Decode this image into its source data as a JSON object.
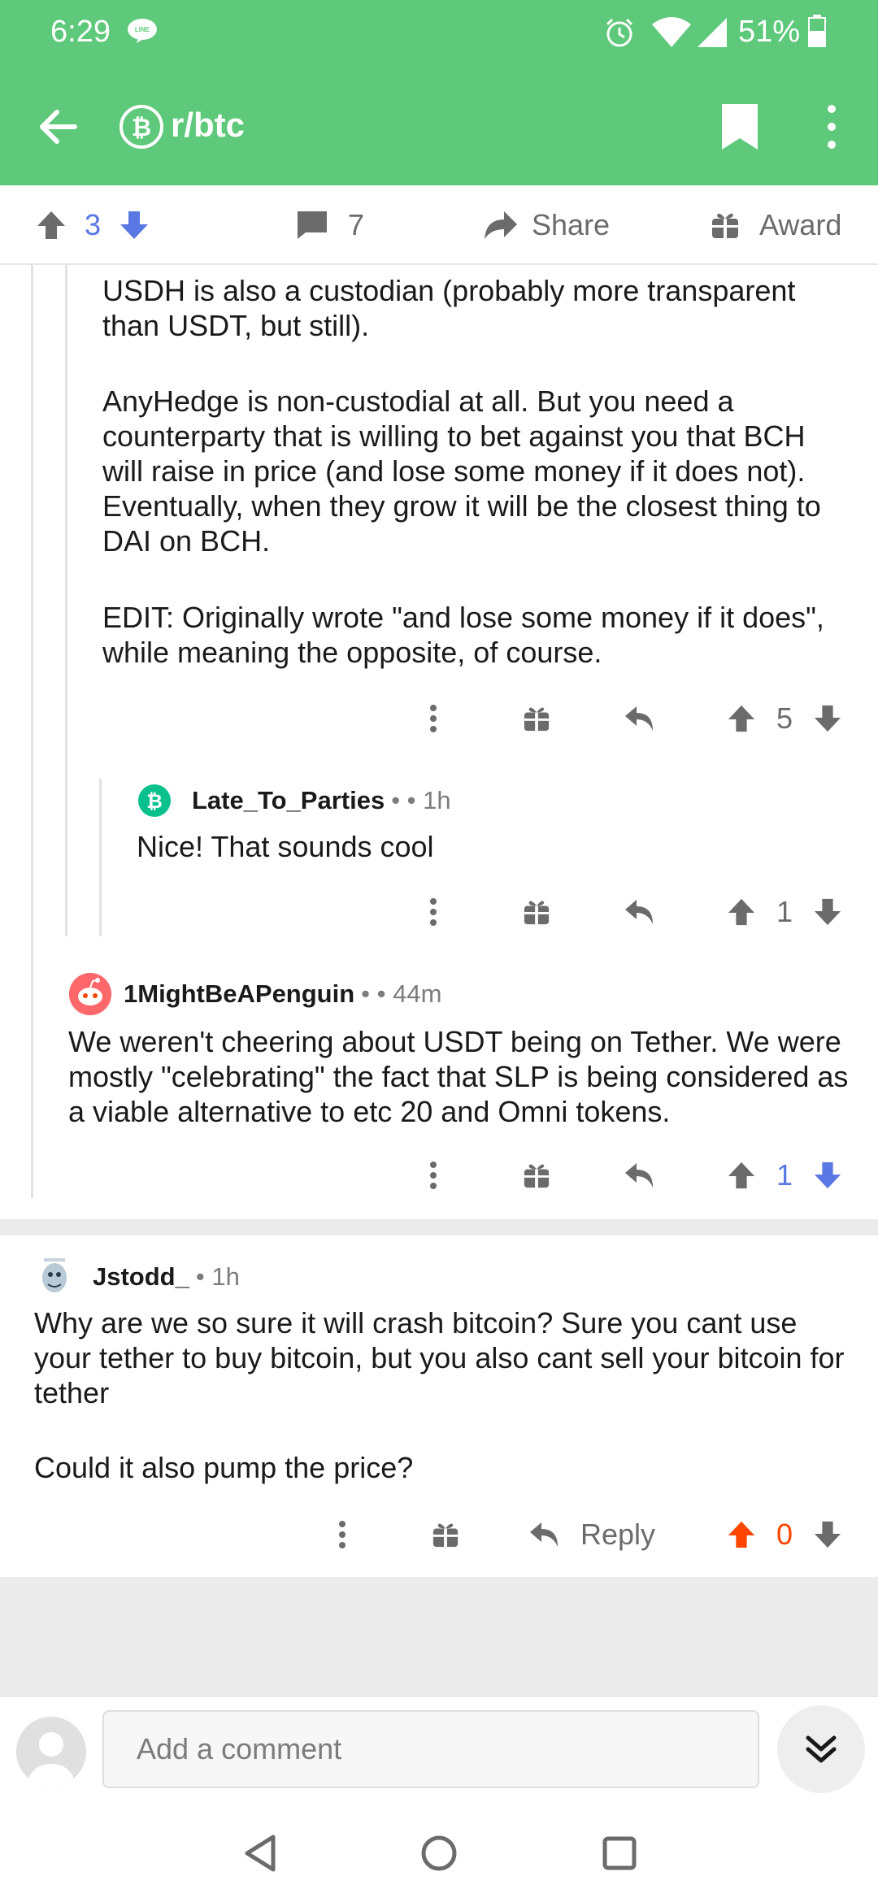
{
  "status_bar": {
    "time": "6:29",
    "battery_percent": "51%",
    "icons": [
      "line-app-icon",
      "alarm-icon",
      "wifi-icon",
      "cell-signal-icon",
      "battery-icon"
    ]
  },
  "toolbar": {
    "subreddit": "r/btc",
    "icons": [
      "back-arrow-icon",
      "bitcoin-subreddit-icon",
      "bookmark-icon",
      "more-vert-icon"
    ]
  },
  "post_actions": {
    "vote_count": "3",
    "comment_count": "7",
    "share_label": "Share",
    "award_label": "Award"
  },
  "comments": [
    {
      "paragraphs": [
        "USDH is also a custodian (probably more transparent than USDT, but still).",
        "AnyHedge is non-custodial at all. But you need a counterparty that is willing to bet against you that BCH will raise in price (and lose some money if it does not). Eventually, when they grow it will be the closest thing to DAI on BCH.",
        "EDIT: Originally wrote \"and lose some money if it does\", while meaning the opposite, of course."
      ],
      "score": "5"
    },
    {
      "author": "Late_To_Parties",
      "meta": "• • 1h",
      "body": "Nice! That sounds cool",
      "score": "1"
    },
    {
      "author": "1MightBeAPenguin",
      "meta": "• • 44m",
      "body": "We weren't cheering about USDT being on Tether. We were mostly \"celebrating\" the fact that SLP is being considered as a viable alternative to etc 20 and Omni tokens.",
      "score": "1"
    },
    {
      "author": "Jstodd_",
      "meta": "• 1h",
      "paragraphs": [
        "Why are we so sure it will crash bitcoin? Sure you cant use your tether to buy bitcoin, but you also cant sell your bitcoin for tether",
        "Could it also pump the price?"
      ],
      "reply_label": "Reply",
      "score": "0"
    }
  ],
  "composer": {
    "placeholder": "Add a comment"
  },
  "colors": {
    "brand_green": "#5ec97a",
    "upvote_orange": "#ff4500",
    "downvote_blue": "#7193ff",
    "bch_green": "#0ac18e"
  }
}
